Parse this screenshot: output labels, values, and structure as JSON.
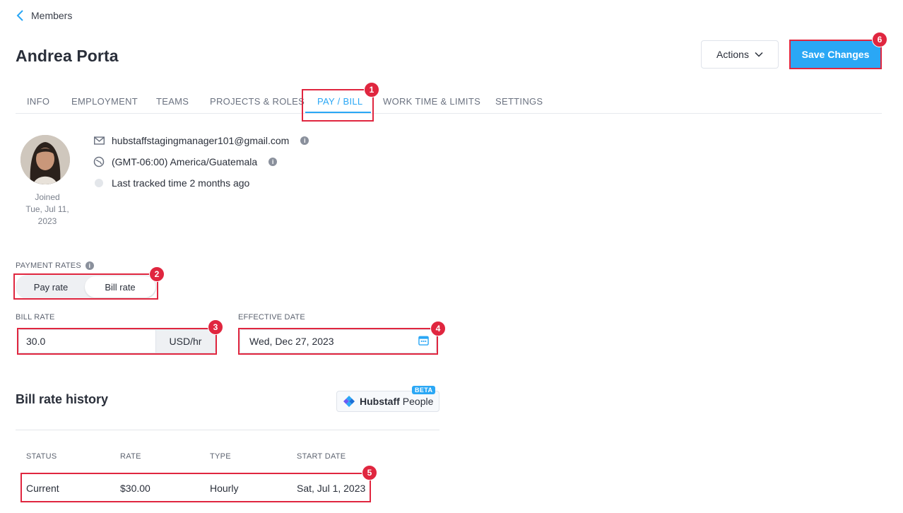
{
  "breadcrumb": {
    "label": "Members"
  },
  "header": {
    "title": "Andrea Porta",
    "actions_label": "Actions",
    "save_label": "Save Changes"
  },
  "tabs": [
    {
      "label": "INFO"
    },
    {
      "label": "EMPLOYMENT"
    },
    {
      "label": "TEAMS"
    },
    {
      "label": "PROJECTS & ROLES"
    },
    {
      "label": "PAY / BILL",
      "active": true
    },
    {
      "label": "WORK TIME & LIMITS"
    },
    {
      "label": "SETTINGS"
    }
  ],
  "profile": {
    "joined_label": "Joined",
    "joined_date": "Tue, Jul 11, 2023",
    "email": "hubstaffstagingmanager101@gmail.com",
    "timezone": "(GMT-06:00) America/Guatemala",
    "last_tracked": "Last tracked time 2 months ago"
  },
  "payment_rates": {
    "label": "PAYMENT RATES",
    "options": [
      "Pay rate",
      "Bill rate"
    ],
    "selected": "Bill rate"
  },
  "bill_rate": {
    "label": "BILL RATE",
    "value": "30.0",
    "unit": "USD/hr"
  },
  "effective_date": {
    "label": "EFFECTIVE DATE",
    "value": "Wed, Dec 27, 2023"
  },
  "history": {
    "title": "Bill rate history",
    "brand_bold": "Hubstaff",
    "brand_light": "People",
    "beta": "BETA",
    "columns": [
      "STATUS",
      "RATE",
      "TYPE",
      "START DATE"
    ],
    "rows": [
      {
        "status": "Current",
        "rate": "$30.00",
        "type": "Hourly",
        "start_date": "Sat, Jul 1, 2023"
      }
    ]
  },
  "annotations": [
    "1",
    "2",
    "3",
    "4",
    "5",
    "6"
  ],
  "colors": {
    "accent": "#2aa7f5",
    "highlight": "#e0263f"
  }
}
